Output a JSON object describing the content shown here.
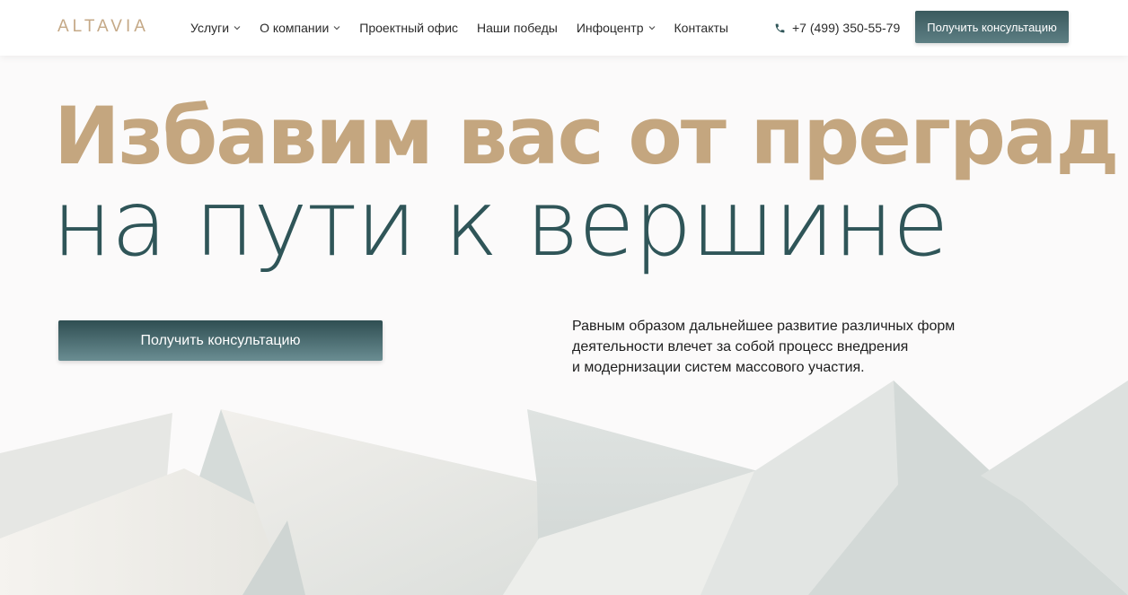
{
  "header": {
    "logo": "ALTAVIA",
    "nav": [
      {
        "label": "Услуги",
        "has_dropdown": true
      },
      {
        "label": "О компании",
        "has_dropdown": true
      },
      {
        "label": "Проектный офис",
        "has_dropdown": false
      },
      {
        "label": "Наши победы",
        "has_dropdown": false
      },
      {
        "label": "Инфоцентр",
        "has_dropdown": true
      },
      {
        "label": "Контакты",
        "has_dropdown": false
      }
    ],
    "phone": "+7 (499) 350-55-79",
    "phone_icon": "phone-icon",
    "cta_label": "Получить консультацию"
  },
  "hero": {
    "title_line1": "Избавим вас от преград",
    "title_line2": "на пути к вершине",
    "cta_label": "Получить консультацию",
    "description_lines": [
      "Равным образом дальнейшее развитие различных форм",
      "деятельности влечет за собой процесс внедрения",
      "и модернизации систем массового участия."
    ]
  },
  "colors": {
    "accent_gold": "#c4a67f",
    "accent_teal": "#2f5558",
    "button": "#4a6a6e"
  }
}
